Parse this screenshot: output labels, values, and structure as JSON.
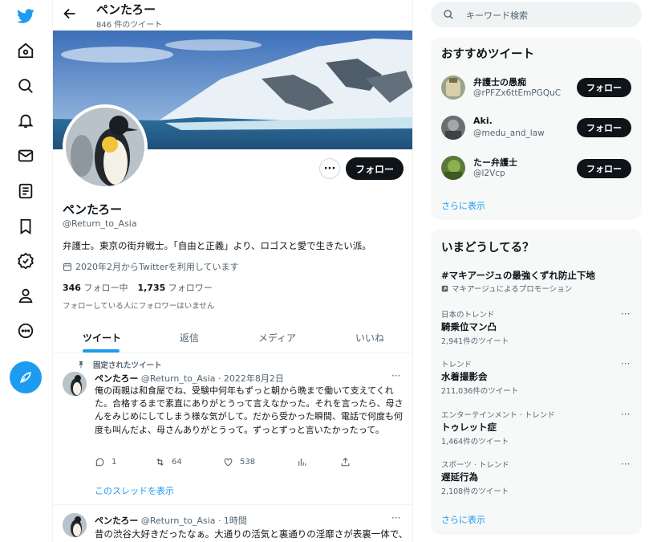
{
  "profile": {
    "top_name": "ペンたろー",
    "tweet_count": "846 件のツイート",
    "name": "ペンたろー",
    "handle": "@Return_to_Asia",
    "bio": "弁護士。東京の街弁戦士。「自由と正義」より、ロゴスと愛で生きたい派。",
    "joined": "2020年2月からTwitterを利用しています",
    "following_count": "346",
    "following_label": "フォロー中",
    "followers_count": "1,735",
    "followers_label": "フォロワー",
    "followers_note": "フォローしている人にフォロワーはいません",
    "follow_button": "フォロー",
    "more_button": "···"
  },
  "tabs": [
    {
      "label": "ツイート"
    },
    {
      "label": "返信"
    },
    {
      "label": "メディア"
    },
    {
      "label": "いいね"
    }
  ],
  "pinned_label": "固定されたツイート",
  "tweets": [
    {
      "name": "ペンたろー",
      "meta": "@Return_to_Asia · 2022年8月2日",
      "text": "俺の両親は和食屋でね、受験中何年もずっと朝から晩まで働いて支えてくれた。合格するまで素直にありがとうって言えなかった。それを言ったら、母さんをみじめにしてしまう様な気がして。だから受かった瞬間、電話で何度も何度も叫んだよ、母さんありがとうって。ずっとずっと言いたかったって。",
      "replies": "1",
      "retweets": "64",
      "likes": "538",
      "thread_link": "このスレッドを表示"
    },
    {
      "name": "ペンたろー",
      "meta": "@Return_to_Asia · 1時間",
      "text": "昔の渋谷大好きだったなぁ。大通りの活気と裏通りの淫靡さが表裏一体で、"
    }
  ],
  "search": {
    "placeholder": "キーワード検索"
  },
  "recommended": {
    "title": "おすすめツイート",
    "users": [
      {
        "name": "弁護士の愚痴",
        "handle": "@rPFZx6ttEmPGQuC",
        "button": "フォロー"
      },
      {
        "name": "Aki.",
        "handle": "@medu_and_law",
        "button": "フォロー"
      },
      {
        "name": "たー弁護士",
        "handle": "@l2Vcp",
        "button": "フォロー"
      }
    ],
    "more": "さらに表示"
  },
  "trends": {
    "title": "いまどうしてる？",
    "promo": {
      "name": "#マキアージュの最強くずれ防止下地",
      "by": "マキアージュによるプロモーション"
    },
    "items": [
      {
        "category": "日本のトレンド",
        "name": "騎乗位マン凸",
        "count": "2,941件のツイート"
      },
      {
        "category": "トレンド",
        "name": "水着撮影会",
        "count": "211,036件のツイート"
      },
      {
        "category": "エンターテインメント · トレンド",
        "name": "トゥレット症",
        "count": "1,464件のツイート"
      },
      {
        "category": "スポーツ · トレンド",
        "name": "遅延行為",
        "count": "2,108件のツイート"
      }
    ],
    "more": "さらに表示"
  },
  "colors": {
    "accent": "#1d9bf0",
    "dark": "#0f1419",
    "muted": "#536471",
    "panel": "#f7f9f9"
  },
  "icons": [
    "twitter-logo-icon",
    "home-icon",
    "explore-icon",
    "notifications-icon",
    "messages-icon",
    "lists-icon",
    "bookmarks-icon",
    "verified-icon",
    "profile-icon",
    "more-icon",
    "compose-icon"
  ]
}
